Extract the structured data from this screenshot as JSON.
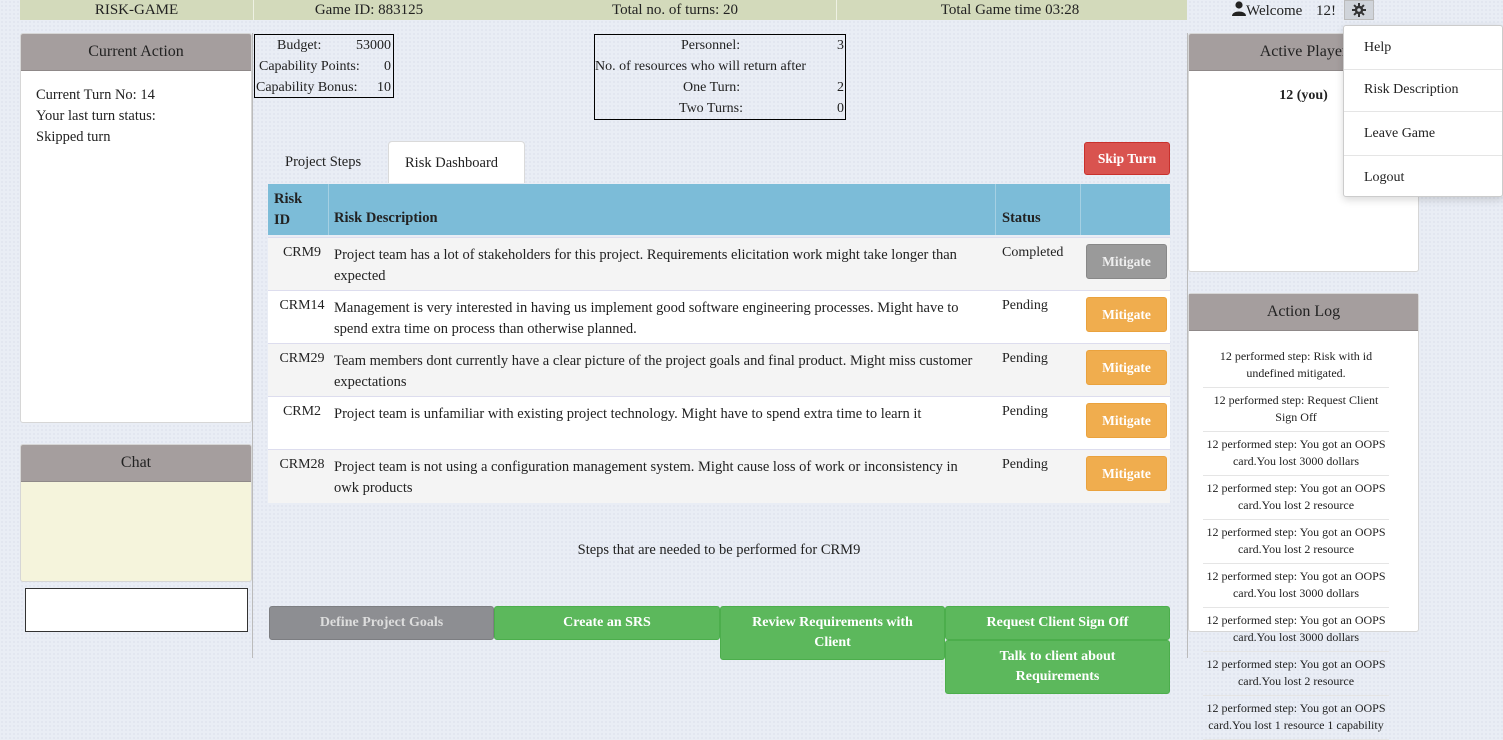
{
  "topbar": {
    "app_title": "RISK-GAME",
    "game_id": "Game ID: 883125",
    "turns": "Total no. of turns: 20",
    "game_time": "Total Game time 03:28"
  },
  "user": {
    "welcome": "Welcome",
    "name": "12!"
  },
  "budget_box": {
    "budget_label": "Budget:",
    "budget_value": "53000",
    "points_label": "Capability Points:",
    "points_value": "0",
    "bonus_label": "Capability Bonus:",
    "bonus_value": "10"
  },
  "personnel_box": {
    "personnel_label": "Personnel:",
    "personnel_value": "3",
    "return_label": "No. of resources who will return after",
    "one_turn_label": "One Turn:",
    "one_turn_value": "2",
    "two_turns_label": "Two Turns:",
    "two_turns_value": "0"
  },
  "current_action": {
    "title": "Current Action",
    "turn_no": "Current Turn No: 14",
    "last_status_label": "Your last turn status:",
    "last_status": "Skipped turn"
  },
  "chat": {
    "title": "Chat",
    "input_value": ""
  },
  "tabs": [
    {
      "label": "Project Steps",
      "active": false
    },
    {
      "label": "Risk Dashboard",
      "active": true
    }
  ],
  "skip_turn": "Skip Turn",
  "risk_table": {
    "headers": {
      "id_line1": "Risk",
      "id_line2": "ID",
      "desc": "Risk Description",
      "status": "Status"
    },
    "rows": [
      {
        "id": "CRM9",
        "desc": "Project team has a lot of stakeholders for this project. Requirements elicitation work might take longer than expected",
        "status": "Completed",
        "action": "Mitigate",
        "enabled": false
      },
      {
        "id": "CRM14",
        "desc": "Management is very interested in having us implement good software engineering processes. Might have to spend extra time on process than otherwise planned.",
        "status": "Pending",
        "action": "Mitigate",
        "enabled": true
      },
      {
        "id": "CRM29",
        "desc": "Team members dont currently have a clear picture of the project goals and final product. Might miss customer expectations",
        "status": "Pending",
        "action": "Mitigate",
        "enabled": true
      },
      {
        "id": "CRM2",
        "desc": "Project team is unfamiliar with existing project technology. Might have to spend extra time to learn it",
        "status": "Pending",
        "action": "Mitigate",
        "enabled": true
      },
      {
        "id": "CRM28",
        "desc": "Project team is not using a configuration management system. Might cause loss of work or inconsistency in owk products",
        "status": "Pending",
        "action": "Mitigate",
        "enabled": true
      }
    ]
  },
  "steps_caption": "Steps that are needed to be performed for CRM9",
  "steps": [
    {
      "label": "Define Project Goals",
      "enabled": false
    },
    {
      "label": "Create an SRS",
      "enabled": true
    },
    {
      "label": "Review Requirements with Client",
      "enabled": true
    },
    {
      "label": "Request Client Sign Off",
      "enabled": true
    },
    {
      "label": "Talk to client about Requirements",
      "enabled": true
    }
  ],
  "active_players": {
    "title": "Active Player",
    "players": [
      "12 (you)"
    ]
  },
  "action_log": {
    "title": "Action Log",
    "entries": [
      "12 performed step: Risk with id undefined mitigated.",
      "12 performed step: Request Client Sign Off",
      "12 performed step: You got an OOPS card.You lost 3000 dollars",
      "12 performed step: You got an OOPS card.You lost 2 resource",
      "12 performed step: You got an OOPS card.You lost 2 resource",
      "12 performed step: You got an OOPS card.You lost 3000 dollars",
      "12 performed step: You got an OOPS card.You lost 3000 dollars",
      "12 performed step: You got an OOPS card.You lost 2 resource",
      "12 performed step: You got an OOPS card.You lost 1 resource 1 capability"
    ]
  },
  "menu": [
    "Help",
    "Risk Description",
    "Leave Game",
    "Logout"
  ]
}
